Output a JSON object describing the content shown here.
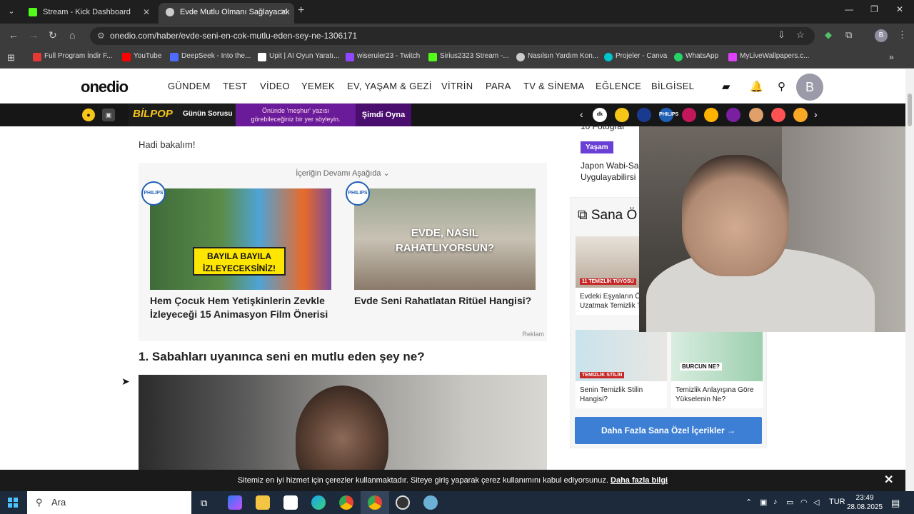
{
  "browser": {
    "tabs": [
      {
        "title": "Stream - Kick Dashboard",
        "favicon_color": "#53fc18",
        "active": false
      },
      {
        "title": "Evde Mutlu Olmanı Sağlayacak",
        "favicon_color": "#aaaaaa",
        "active": true
      }
    ],
    "url": "onedio.com/haber/evde-seni-en-cok-mutlu-eden-sey-ne-1306171",
    "profile_initial": "B",
    "bookmarks": [
      {
        "label": "Full Program İndir F...",
        "color": "#e53935"
      },
      {
        "label": "YouTube",
        "color": "#ff0000"
      },
      {
        "label": "DeepSeek - Into the...",
        "color": "#4d6bfe"
      },
      {
        "label": "Upit | AI Oyun Yaratı...",
        "color": "#ffffff"
      },
      {
        "label": "wiseruler23 - Twitch",
        "color": "#9146ff"
      },
      {
        "label": "Sirius2323 Stream -...",
        "color": "#53fc18"
      },
      {
        "label": "Nasılsın Yardım Kon...",
        "color": "#cccccc"
      },
      {
        "label": "Projeler - Canva",
        "color": "#00c4cc"
      },
      {
        "label": "WhatsApp",
        "color": "#25d366"
      },
      {
        "label": "MyLiveWallpapers.c...",
        "color": "#e040fb"
      }
    ]
  },
  "site": {
    "logo": "onedio",
    "nav": [
      "GÜNDEM",
      "TEST",
      "VİDEO",
      "YEMEK",
      "EV, YAŞAM & GEZİ",
      "VİTRİN",
      "PARA",
      "TV & SİNEMA",
      "EĞLENCE",
      "BİLGİSEL"
    ],
    "avatar_initial": "B"
  },
  "promo": {
    "bilpop": "BİLPOP",
    "daily_question": "Günün Sorusu",
    "quiz_line1": "Önünde 'meşhur' yazısı",
    "quiz_line2": "görebileceğiniz bir yer söyleyin.",
    "play_label": "Şimdi Oyna",
    "stories": [
      "dk",
      "",
      "",
      "PHILIPS",
      "",
      "",
      "",
      "",
      "",
      ""
    ]
  },
  "article": {
    "intro": "Hadi bakalım!",
    "more_content": "İçeriğin Devamı Aşağıda",
    "cards": [
      {
        "title": "Hem Çocuk Hem Yetişkinlerin Zevkle İzleyeceği 15 Animasyon Film Önerisi",
        "overlay": "BAYILA BAYILA İZLEYECEKSİNİZ!",
        "brand": "PHILIPS"
      },
      {
        "title": "Evde Seni Rahatlatan Ritüel Hangisi?",
        "overlay": "EVDE, NASIL RAHATLIYORSUN?",
        "brand": "PHILIPS"
      }
    ],
    "ad_label": "Reklam",
    "question_heading": "1. Sabahları uyanınca seni en mutlu eden şey ne?"
  },
  "sidebar": {
    "snippet": "10 Fotoğraf",
    "tag": "Yaşam",
    "headline": "Japon Wabi-Sa\nUygulayabilirsi",
    "sana_title": "Sana Ö",
    "cards": [
      {
        "label": "Evdeki Eşyaların Ömrünü Uzatmak Temizlik Tüyosu",
        "overlay": "11 TEMİZLİK TÜYOSU"
      },
      {
        "label": "Senin Temizlik Stilin Hangisi?",
        "overlay": "TEMİZLİK STİLİN"
      },
      {
        "label": "Temizlik Anlayışına Göre Yükselenin Ne?",
        "overlay": "BURCUN NE?"
      }
    ],
    "more_button": "Daha Fazla Sana Özel İçerikler"
  },
  "cookie": {
    "text": "Sitemiz en iyi hizmet için çerezler kullanmaktadır. Siteye giriş yaparak çerez kullanımını kabul ediyorsunuz.",
    "link": "Daha fazla bilgi"
  },
  "taskbar": {
    "search_placeholder": "Ara",
    "lang": "TUR",
    "time": "23:49",
    "date": "28.08.2025"
  }
}
